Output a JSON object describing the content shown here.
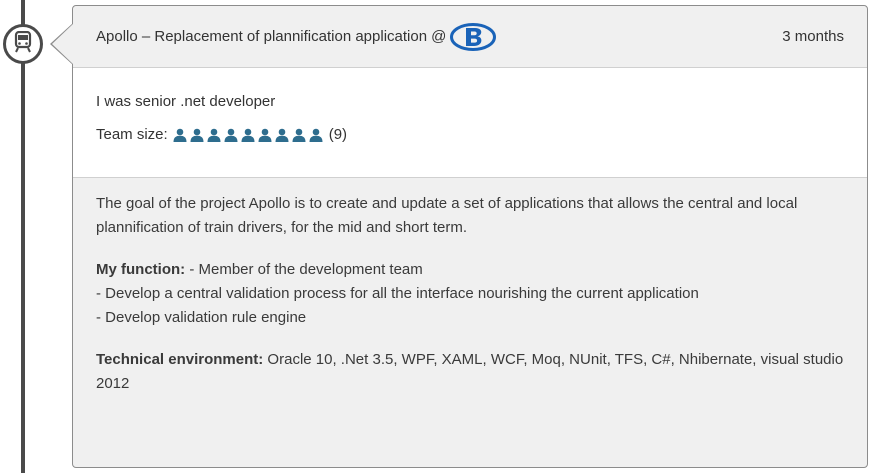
{
  "project": {
    "title": "Apollo – Replacement of plannification application",
    "at_symbol": "@",
    "client_logo": "sncb-b-logo",
    "duration": "3 months",
    "icon": "train-icon"
  },
  "meta": {
    "role": "I was senior .net developer",
    "team_label": "Team size:",
    "team_size": 9,
    "team_count_text": "(9)",
    "person_icon": "person-icon",
    "person_color": "#2e6d8e"
  },
  "description": {
    "goal": "The goal of the project Apollo is to create and update a set of applications that allows the central and local plannification of train drivers, for the mid and short term.",
    "function_label": "My function:",
    "function_intro": " - Member of the development team",
    "function_items": [
      "- Develop a central validation process for all the interface nourishing the current application",
      "- Develop validation rule engine"
    ],
    "tech_label": "Technical environment:",
    "tech_value": " Oracle 10, .Net 3.5, WPF, XAML, WCF, Moq, NUnit, TFS, C#, Nhibernate, visual studio 2012"
  },
  "colors": {
    "timeline": "#4a4a4a",
    "logo_blue": "#1a63b8",
    "card_bg": "#f0f0f0"
  }
}
